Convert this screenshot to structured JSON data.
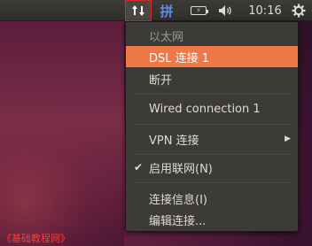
{
  "panel": {
    "network_icon": "network-updown-icon",
    "input_method_label": "拼",
    "battery_icon": "battery-icon",
    "volume_icon": "volume-icon",
    "clock": "10:16",
    "settings_icon": "gear-icon"
  },
  "menu": {
    "header": "以太网",
    "dsl": "DSL 连接 1",
    "disconnect": "断开",
    "wired": "Wired connection 1",
    "vpn": "VPN 连接",
    "vpn_arrow": "▶",
    "enable_network_check": "✔",
    "enable_network": "启用联网(N)",
    "connection_info": "连接信息(I)",
    "edit_connections": "编辑连接..."
  },
  "watermark": "《基础教程网》",
  "colors": {
    "highlight": "#f07746",
    "panel_bg": "#3c3b37",
    "watermark": "#ff3b3b"
  }
}
